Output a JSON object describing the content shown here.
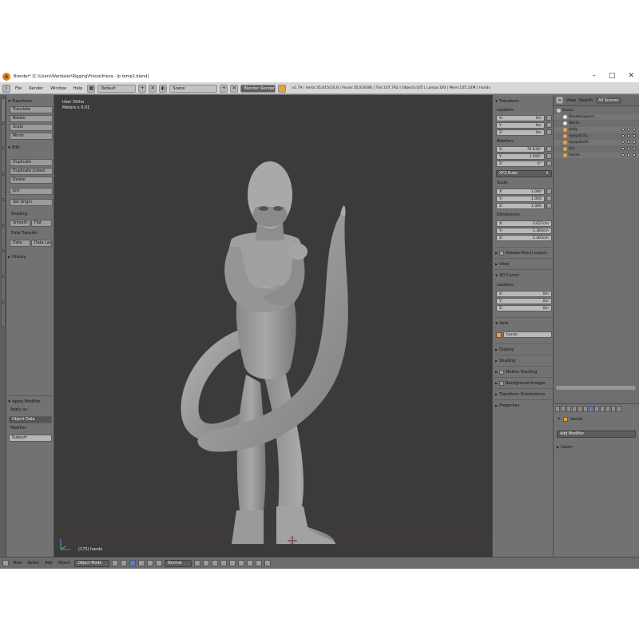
{
  "window": {
    "title": "Blender* [C:\\Users\\Wardialer\\Rigging\\Frieza\\frieza - lp temp2.blend]",
    "controls": [
      "–",
      "□",
      "✕"
    ]
  },
  "infobar": {
    "menus": [
      "File",
      "Render",
      "Window",
      "Help"
    ],
    "layout": "Default",
    "scene": "Scene",
    "engine": "Blender Render",
    "stats": "v2.79 | Verts:35,815/10,6 | Faces:35,816/86 | Tris:107,792 | Objects:0/5 | Lamps:0/0 | Mem:105.14M | hands"
  },
  "toolshelf": {
    "transform": {
      "header": "Transform",
      "buttons": [
        "Translate",
        "Rotate",
        "Scale",
        "Mirror"
      ]
    },
    "edit": {
      "header": "Edit",
      "buttons": [
        "Duplicate",
        "Duplicate Linked",
        "Delete",
        "Join",
        "Set Origin"
      ],
      "shading_label": "Shading:",
      "shading_buttons": [
        "Smooth",
        "Flat"
      ],
      "data_transfer_label": "Data Transfer:",
      "data_buttons": [
        "Data",
        "Data Lay"
      ]
    },
    "history": {
      "header": "History"
    },
    "operator": {
      "header": "Apply Modifier",
      "apply_as_label": "Apply as:",
      "apply_as_value": "Object Data",
      "modifier_label": "Modifier:",
      "modifier_value": "Subsurf"
    }
  },
  "viewport": {
    "view_name": "User Ortho",
    "meters": "Meters x 0.01",
    "object_label": "(175) hands"
  },
  "properties": {
    "transform_header": "Transform",
    "location_label": "Location:",
    "location": [
      [
        "X:",
        "0m"
      ],
      [
        "Y:",
        "0m"
      ],
      [
        "Z:",
        "0m"
      ]
    ],
    "rotation_label": "Rotation:",
    "rotation": [
      [
        "X:",
        "78.838°"
      ],
      [
        "Y:",
        "2.590°"
      ],
      [
        "Z:",
        "0°"
      ]
    ],
    "rotation_mode": "XYZ Euler",
    "scale_label": "Scale:",
    "scale": [
      [
        "X:",
        "1.000"
      ],
      [
        "Y:",
        "1.000"
      ],
      [
        "Z:",
        "1.000"
      ]
    ],
    "dimensions_label": "Dimensions:",
    "dimensions": [
      [
        "X:",
        "3.027cm"
      ],
      [
        "Y:",
        "1.360cm"
      ],
      [
        "Z:",
        "2.403cm"
      ]
    ],
    "grease_pencil": "Grease Pencil Layers",
    "view": "View",
    "cursor_header": "3D Cursor",
    "cursor_location_label": "Location:",
    "cursor": [
      [
        "X:",
        "0m"
      ],
      [
        "Y:",
        "0m"
      ],
      [
        "Z:",
        "0m"
      ]
    ],
    "item_header": "Item",
    "item_name": "hands",
    "collapsed": [
      "Display",
      "Shading",
      "Motion Tracking",
      "Background Images",
      "Transform Orientations",
      "Properties"
    ]
  },
  "outliner": {
    "menus": [
      "View",
      "Search"
    ],
    "filter": "All Scenes",
    "rows": [
      {
        "label": "Scene",
        "color": "#cfcfcf"
      },
      {
        "label": "RenderLayers",
        "color": "#e6e6e6"
      },
      {
        "label": "World",
        "color": "#cfe3ff"
      },
      {
        "label": "body",
        "color": "#f0a040"
      },
      {
        "label": "eyepatchL",
        "color": "#f0a040"
      },
      {
        "label": "eyepatchR",
        "color": "#f0a040"
      },
      {
        "label": "tail",
        "color": "#f0a040"
      },
      {
        "label": "hands",
        "color": "#f0a040"
      }
    ]
  },
  "modifier_panel": {
    "object_name": "hands",
    "add_modifier": "Add Modifier",
    "modifier": "Geom"
  },
  "bottombar": {
    "menus": [
      "View",
      "Select",
      "Add",
      "Object"
    ],
    "mode": "Object Mode",
    "pivot": "Normal"
  }
}
